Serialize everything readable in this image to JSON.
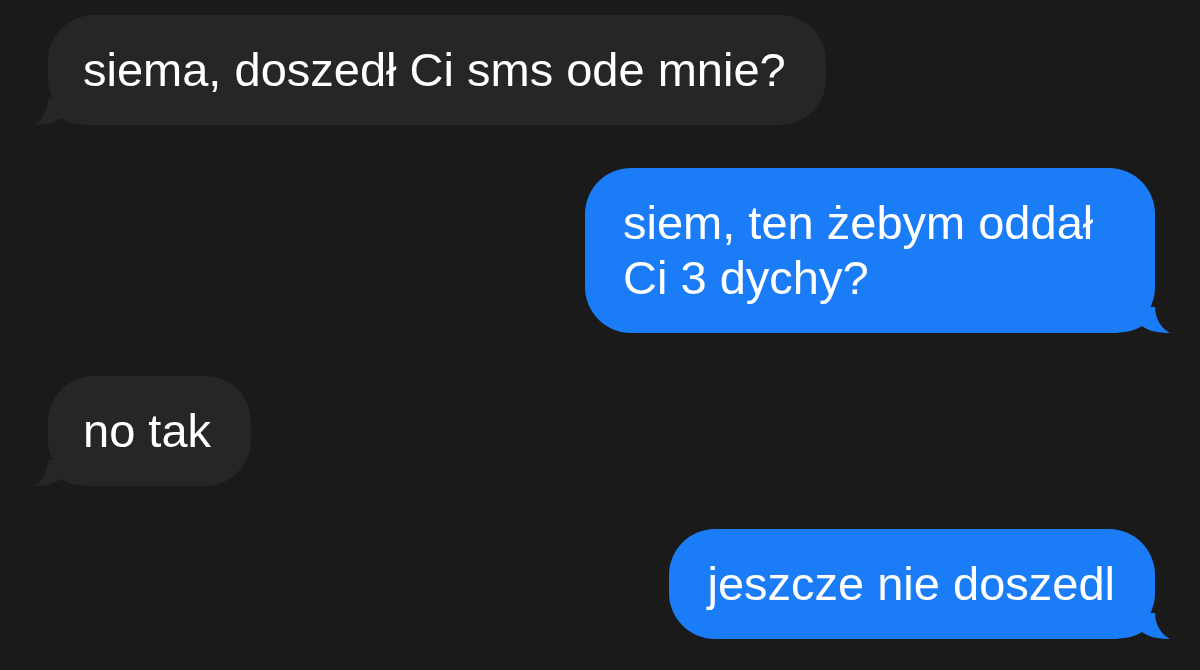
{
  "messages": [
    {
      "kind": "incoming",
      "text": "siema, doszedł Ci sms ode mnie?"
    },
    {
      "kind": "outgoing",
      "text": "siem, ten żebym oddał Ci 3 dychy?"
    },
    {
      "kind": "incoming",
      "text": "no tak"
    },
    {
      "kind": "outgoing",
      "text": "jeszcze nie doszedl"
    }
  ]
}
